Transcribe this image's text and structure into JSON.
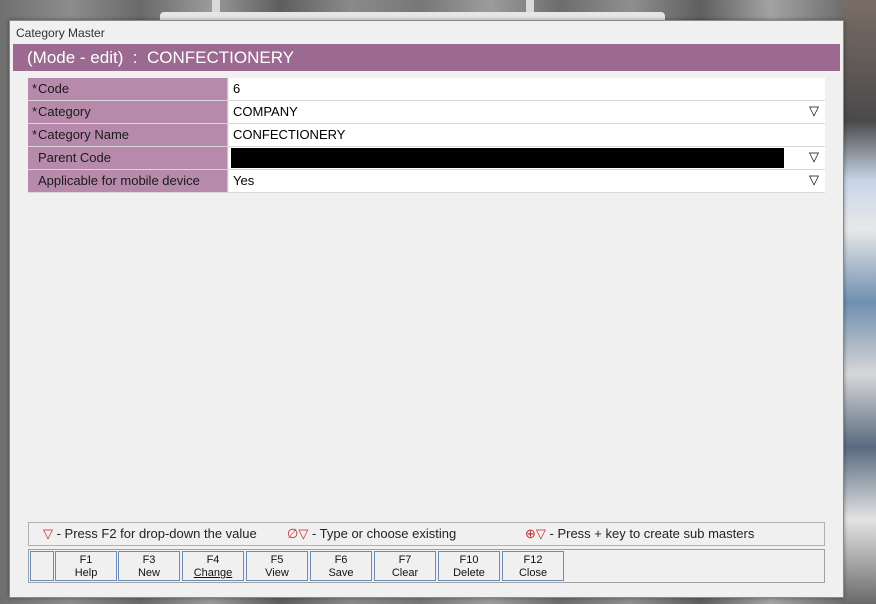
{
  "window": {
    "title": "Category Master"
  },
  "mode_bar": {
    "text": "(Mode - edit)  :  CONFECTIONERY"
  },
  "fields": [
    {
      "label": "Code",
      "required": true,
      "value": "6",
      "dropdown": false
    },
    {
      "label": "Category",
      "required": true,
      "value": "COMPANY",
      "dropdown": true
    },
    {
      "label": "Category Name",
      "required": true,
      "value": "CONFECTIONERY",
      "dropdown": false
    },
    {
      "label": "Parent Code",
      "required": false,
      "value": "",
      "dropdown": true,
      "highlighted": true
    },
    {
      "label": "Applicable for mobile device",
      "required": false,
      "value": "Yes",
      "dropdown": true
    }
  ],
  "legend": [
    {
      "symbol": "▽",
      "text": " - Press F2 for drop-down the value"
    },
    {
      "symbol": "∅▽",
      "text": " - Type or choose existing"
    },
    {
      "symbol": "⊕▽",
      "text": " - Press + key to create sub masters"
    }
  ],
  "function_keys": [
    {
      "key": "F1",
      "label": "Help"
    },
    {
      "key": "F3",
      "label": "New"
    },
    {
      "key": "F4",
      "label": "Change",
      "active": true
    },
    {
      "key": "F5",
      "label": "View"
    },
    {
      "key": "F6",
      "label": "Save"
    },
    {
      "key": "F7",
      "label": "Clear"
    },
    {
      "key": "F10",
      "label": "Delete"
    },
    {
      "key": "F12",
      "label": "Close"
    }
  ],
  "glyphs": {
    "required_marker": "*",
    "dropdown": "▽"
  },
  "colors": {
    "accent": "#9c6a91",
    "label_bg": "#b78aab",
    "legend_symbol": "#c0282c"
  }
}
